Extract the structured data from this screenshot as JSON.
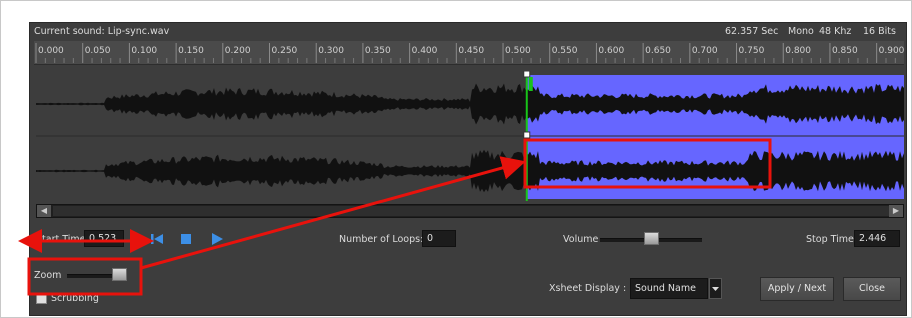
{
  "header": {
    "current_sound": "Current sound: Lip-sync.wav",
    "duration": "62.357 Sec",
    "channels": "Mono",
    "sample_rate": "48 Khz",
    "bit_depth": "16 Bits"
  },
  "ruler": {
    "ticks": [
      "0.000",
      "0.050",
      "0.100",
      "0.150",
      "0.200",
      "0.250",
      "0.300",
      "0.350",
      "0.400",
      "0.450",
      "0.500",
      "0.550",
      "0.600",
      "0.650",
      "0.700",
      "0.750",
      "0.800",
      "0.850",
      "0.900"
    ],
    "range": [
      0.0,
      0.925
    ]
  },
  "waveform": {
    "selection_start": 0.523,
    "selection_color": "#6666ff",
    "playhead_color": "#19c419"
  },
  "controls": {
    "start_time_label": "Start Time",
    "start_time_value": "0.523",
    "loops_label": "Number of Loops:",
    "loops_value": "0",
    "volume_label": "Volume",
    "volume_level": 0.5,
    "stop_time_label": "Stop Time",
    "stop_time_value": "2.446",
    "zoom_label": "Zoom",
    "zoom_level": 0.9,
    "scrubbing_label": "Scrubbing",
    "xsheet_label": "Xsheet Display :",
    "xsheet_value": "Sound Name",
    "apply_next_label": "Apply / Next",
    "close_label": "Close"
  },
  "icons": {
    "rewind": "skip-to-start-icon",
    "stop": "stop-icon",
    "play": "play-icon",
    "dropdown": "chevron-down-icon"
  },
  "colors": {
    "annotation": "#e8120c",
    "transport": "#3d8fe6",
    "panel": "#3d3d3d"
  }
}
